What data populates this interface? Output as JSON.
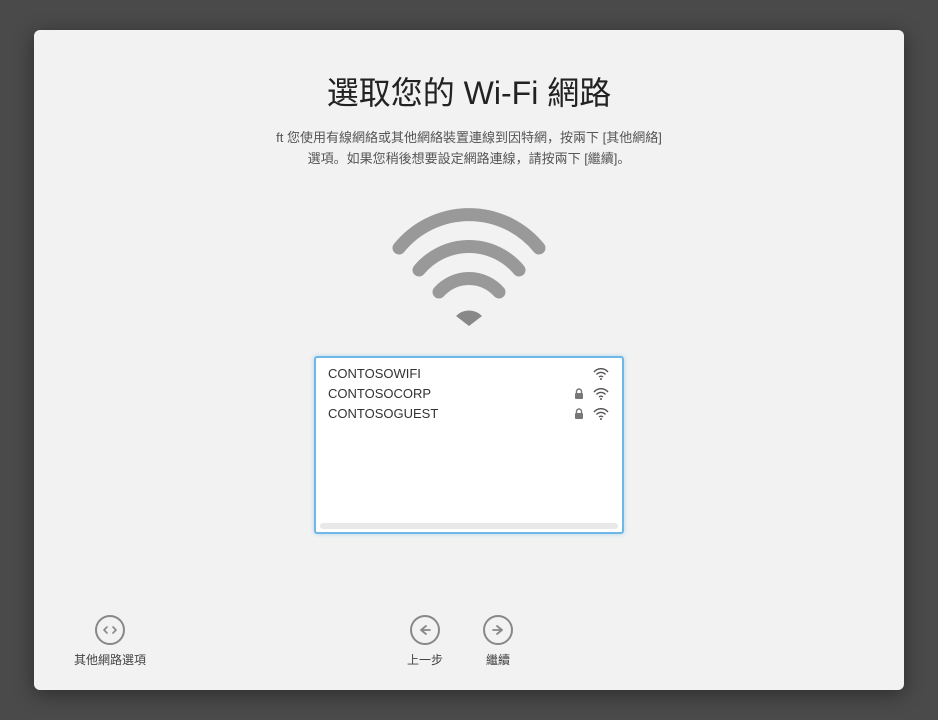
{
  "header": {
    "title": "選取您的 Wi-Fi 網路",
    "subtitle_line1": "ft 您使用有線網絡或其他網絡裝置連線到因特網，按兩下 [其他網絡]",
    "subtitle_line2": "選項。如果您稍後想要設定網路連線，請按兩下 [繼續]。"
  },
  "networks": [
    {
      "name": "CONTOSOWIFI",
      "locked": false,
      "signal": 3
    },
    {
      "name": "CONTOSOCORP",
      "locked": true,
      "signal": 3
    },
    {
      "name": "CONTOSOGUEST",
      "locked": true,
      "signal": 3
    }
  ],
  "footer": {
    "other_options": "其他網路選項",
    "back": "上一步",
    "continue": "繼續"
  }
}
